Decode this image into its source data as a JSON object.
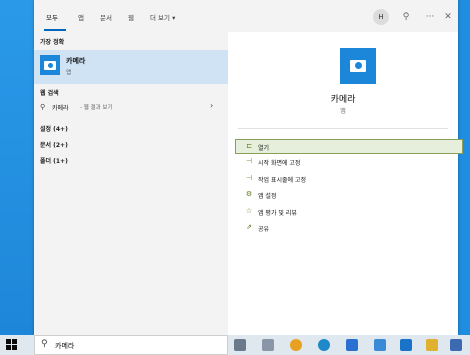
{
  "tabs": [
    {
      "label": "모두",
      "active": true
    },
    {
      "label": "앱"
    },
    {
      "label": "문서"
    },
    {
      "label": "웹"
    },
    {
      "label": "더 보기 ▾"
    }
  ],
  "topbar": {
    "avatar_letter": "H"
  },
  "left": {
    "best_match_header": "가장 정확",
    "best_match": {
      "title": "카메라",
      "subtitle": "앱"
    },
    "web_header": "웹 검색",
    "web_query": "카메라",
    "web_suffix": " - 웹 결과 보기",
    "settings": "설정 (4+)",
    "documents": "문서 (2+)",
    "folders": "폴더 (1+)"
  },
  "right": {
    "app_name": "카메라",
    "app_type": "앱",
    "actions": [
      {
        "label": "열기",
        "icon": "open-icon",
        "selected": true
      },
      {
        "label": "시작 화면에 고정",
        "icon": "pin-icon"
      },
      {
        "label": "작업 표시줄에 고정",
        "icon": "pin-icon"
      },
      {
        "label": "앱 설정",
        "icon": "gear-icon"
      },
      {
        "label": "앱 평가 및 리뷰",
        "icon": "star-icon"
      },
      {
        "label": "공유",
        "icon": "share-icon"
      }
    ]
  },
  "taskbar": {
    "search_text": "카메라"
  },
  "colors": {
    "accent": "#0067c0",
    "app_tile": "#1c87d8",
    "selected_bg": "#e6eedc"
  }
}
